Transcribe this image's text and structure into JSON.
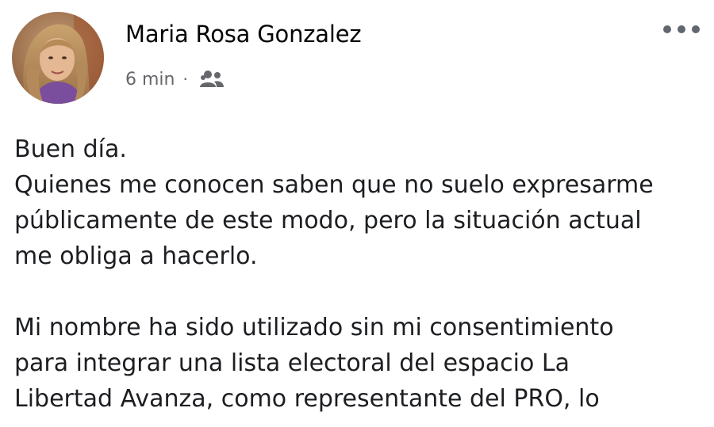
{
  "post": {
    "author": "Maria Rosa Gonzalez",
    "timestamp": "6 min",
    "separator": "·",
    "audience_icon": "friends-icon",
    "more_icon": "more-options-icon",
    "body": {
      "paragraph_1": "Buen día.\nQuienes me conocen saben que no suelo expresarme\npúblicamente de este modo, pero la situación actual\nme obliga a hacerlo.",
      "paragraph_2": "Mi nombre ha sido utilizado sin mi consentimiento\npara integrar una lista electoral del espacio La\nLibertad Avanza, como representante del PRO,  lo"
    }
  },
  "colors": {
    "text_primary": "#1c1e21",
    "text_secondary": "#65676b",
    "background": "#ffffff"
  }
}
